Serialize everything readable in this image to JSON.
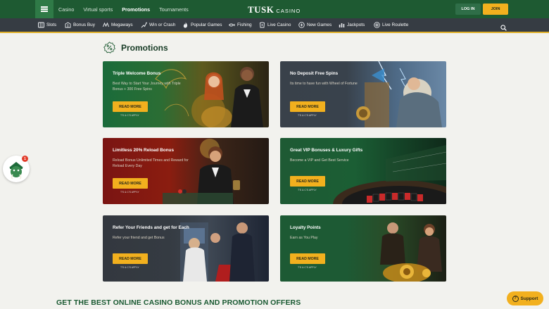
{
  "topbar": {
    "nav": [
      "Casino",
      "Virtual sports",
      "Promotions",
      "Tournaments"
    ],
    "active_nav": "Promotions",
    "logo_main": "TUSK",
    "logo_sub": "CASINO",
    "login_label": "LOG IN",
    "join_label": "JOIN"
  },
  "categories": [
    {
      "label": "Slots",
      "icon": "slots-icon"
    },
    {
      "label": "Bonus Buy",
      "icon": "bonus-buy-icon"
    },
    {
      "label": "Megaways",
      "icon": "megaways-icon"
    },
    {
      "label": "Win or Crash",
      "icon": "win-or-crash-icon"
    },
    {
      "label": "Popular Games",
      "icon": "flame-icon"
    },
    {
      "label": "Fishing",
      "icon": "fishing-icon"
    },
    {
      "label": "Live Casino",
      "icon": "live-casino-icon"
    },
    {
      "label": "New Games",
      "icon": "new-games-icon"
    },
    {
      "label": "Jackpots",
      "icon": "jackpots-icon"
    },
    {
      "label": "Live Roulette",
      "icon": "roulette-icon"
    }
  ],
  "page_title": "Promotions",
  "cards": [
    {
      "title": "Triple Welcome Bonus",
      "desc": "Best Way to Start Your Journey with Triple Bonus + 300 Free Spins",
      "button": "READ MORE",
      "tc": "T'S & C'S APPLY"
    },
    {
      "title": "No Deposit Free Spins",
      "desc": "Its time to have fun with Wheel of Fortune",
      "button": "READ MORE",
      "tc": "T'S & C'S APPLY"
    },
    {
      "title": "Limitless 20% Reload Bonus",
      "desc": "Reload Bonus Unlimited Times and Reward for Reload Every Day",
      "button": "READ MORE",
      "tc": "T'S & C'S APPLY"
    },
    {
      "title": "Great VIP Bonuses & Luxury Gifts",
      "desc": "Become a VIP and Get Best Service",
      "button": "READ MORE",
      "tc": "T'S & C'S APPLY"
    },
    {
      "title": "Refer Your Friends and get for Each",
      "desc": "Refer your friend and get Bonus",
      "button": "READ MORE",
      "tc": "T'S & C'S APPLY"
    },
    {
      "title": "Loyalty Points",
      "desc": "Earn as You Play",
      "button": "READ MORE",
      "tc": "T'S & C'S APPLY"
    }
  ],
  "bottom_heading": "GET THE BEST ONLINE CASINO BONUS AND PROMOTION OFFERS",
  "mascot_badge": "1",
  "support_label": "Support",
  "colors": {
    "brand_green": "#1e5a32",
    "accent_yellow": "#f2b01e",
    "category_bar": "#363c43"
  }
}
